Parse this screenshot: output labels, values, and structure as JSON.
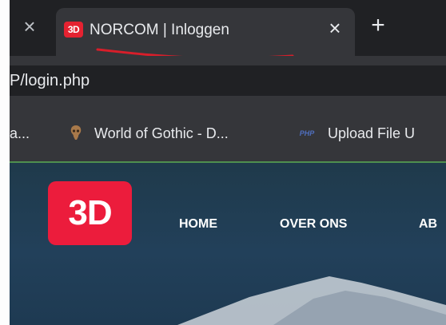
{
  "tab": {
    "favicon_text": "3D",
    "title": "NORCOM | Inloggen",
    "close_label": "×",
    "new_tab_label": "+",
    "prev_close_label": "×"
  },
  "address_bar": {
    "url": "P/login.php"
  },
  "bookmarks": [
    {
      "label": "a...",
      "icon": ""
    },
    {
      "label": "World of Gothic - D...",
      "icon": "gothic-skull-icon"
    },
    {
      "label": "Upload File U",
      "icon": "php-icon",
      "icon_text": "PHP"
    }
  ],
  "site": {
    "logo_text": "3D",
    "nav": [
      "HOME",
      "OVER ONS",
      "AB"
    ]
  },
  "colors": {
    "brand_red": "#ec1c3c",
    "tab_bg": "#35363a",
    "strip_bg": "#202124",
    "annotation_red": "#d81e2a"
  }
}
